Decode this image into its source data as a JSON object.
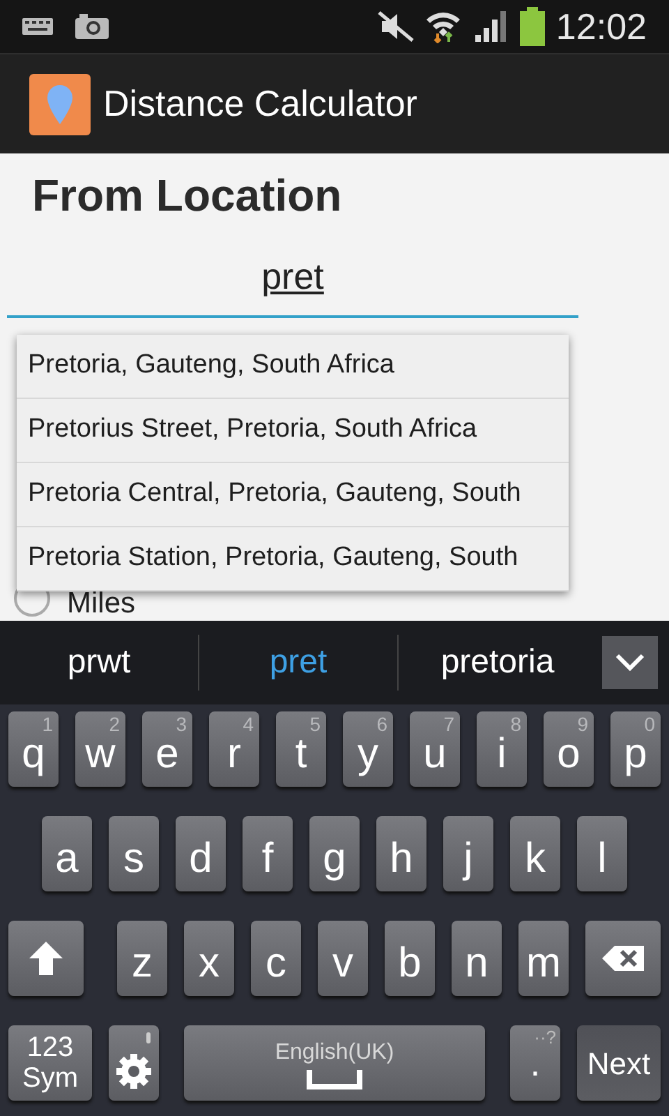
{
  "status_bar": {
    "time": "12:02"
  },
  "app_bar": {
    "title": "Distance Calculator"
  },
  "heading": "From Location",
  "location_field": {
    "value": "pret"
  },
  "suggestions": [
    {
      "text": "Pretoria, Gauteng, South Africa"
    },
    {
      "text": "Pretorius Street, Pretoria, South Africa"
    },
    {
      "text": "Pretoria Central, Pretoria, Gauteng, South"
    },
    {
      "text": "Pretoria Station, Pretoria, Gauteng, South"
    }
  ],
  "units": [
    {
      "label": "Miles",
      "selected": false
    }
  ],
  "keyboard": {
    "predictions": [
      {
        "text": "prwt",
        "selected": false
      },
      {
        "text": "pret",
        "selected": true
      },
      {
        "text": "pretoria",
        "selected": false
      }
    ],
    "rows": [
      [
        {
          "key": "q",
          "hint": "1"
        },
        {
          "key": "w",
          "hint": "2"
        },
        {
          "key": "e",
          "hint": "3"
        },
        {
          "key": "r",
          "hint": "4"
        },
        {
          "key": "t",
          "hint": "5"
        },
        {
          "key": "y",
          "hint": "6"
        },
        {
          "key": "u",
          "hint": "7"
        },
        {
          "key": "i",
          "hint": "8"
        },
        {
          "key": "o",
          "hint": "9"
        },
        {
          "key": "p",
          "hint": "0"
        }
      ],
      [
        {
          "key": "a"
        },
        {
          "key": "s"
        },
        {
          "key": "d"
        },
        {
          "key": "f"
        },
        {
          "key": "g"
        },
        {
          "key": "h"
        },
        {
          "key": "j"
        },
        {
          "key": "k"
        },
        {
          "key": "l"
        }
      ],
      [
        {
          "key": "z"
        },
        {
          "key": "x"
        },
        {
          "key": "c"
        },
        {
          "key": "v"
        },
        {
          "key": "b"
        },
        {
          "key": "n"
        },
        {
          "key": "m"
        }
      ]
    ],
    "sym_key": [
      "123",
      "Sym"
    ],
    "space_label": "English(UK)",
    "period_key": ".",
    "period_hint": "··?",
    "action_key": "Next"
  }
}
